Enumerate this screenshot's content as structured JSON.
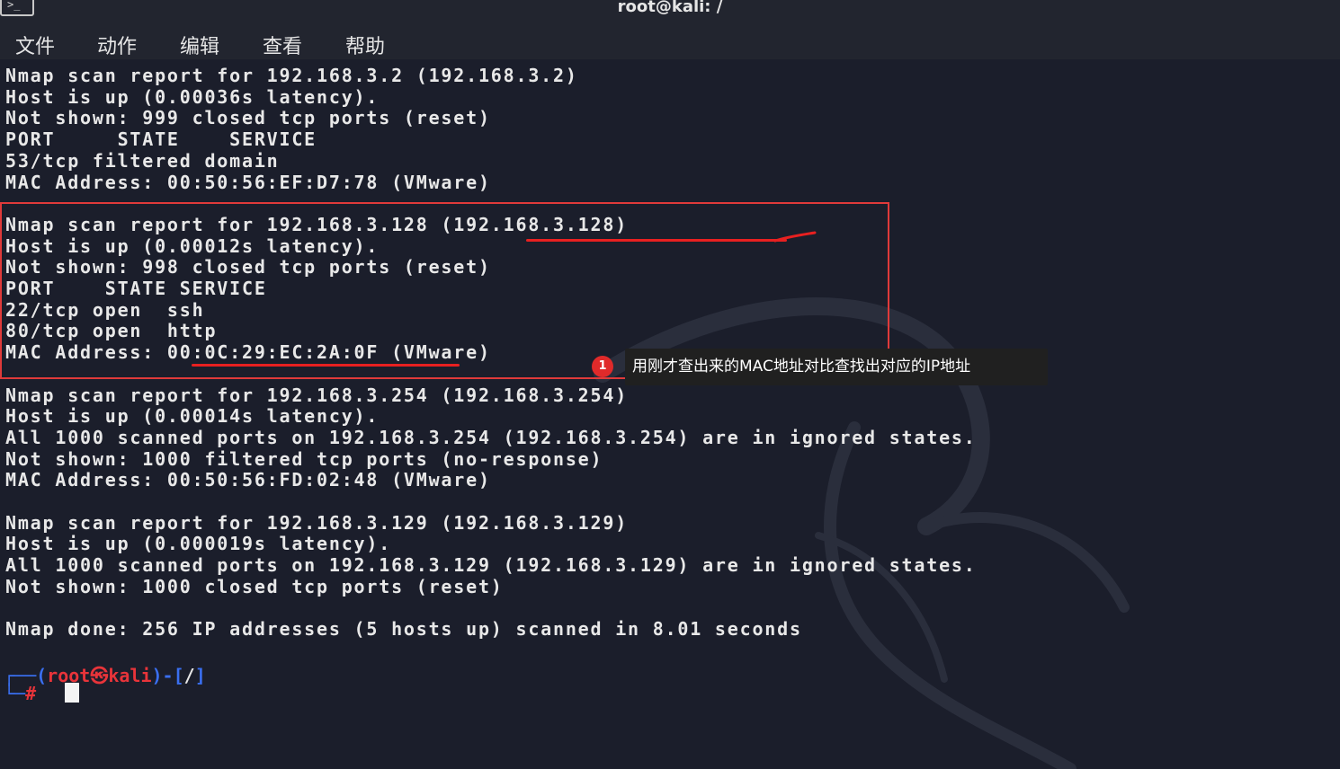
{
  "window": {
    "title": "root@kali: /"
  },
  "menu": [
    "文件",
    "动作",
    "编辑",
    "查看",
    "帮助"
  ],
  "terminal_lines": [
    "Nmap scan report for 192.168.3.2 (192.168.3.2)",
    "Host is up (0.00036s latency).",
    "Not shown: 999 closed tcp ports (reset)",
    "PORT     STATE    SERVICE",
    "53/tcp filtered domain",
    "MAC Address: 00:50:56:EF:D7:78 (VMware)",
    "",
    "Nmap scan report for 192.168.3.128 (192.168.3.128)",
    "Host is up (0.00012s latency).",
    "Not shown: 998 closed tcp ports (reset)",
    "PORT    STATE SERVICE",
    "22/tcp open  ssh",
    "80/tcp open  http",
    "MAC Address: 00:0C:29:EC:2A:0F (VMware)",
    "",
    "Nmap scan report for 192.168.3.254 (192.168.3.254)",
    "Host is up (0.00014s latency).",
    "All 1000 scanned ports on 192.168.3.254 (192.168.3.254) are in ignored states.",
    "Not shown: 1000 filtered tcp ports (no-response)",
    "MAC Address: 00:50:56:FD:02:48 (VMware)",
    "",
    "Nmap scan report for 192.168.3.129 (192.168.3.129)",
    "Host is up (0.000019s latency).",
    "All 1000 scanned ports on 192.168.3.129 (192.168.3.129) are in ignored states.",
    "Not shown: 1000 closed tcp ports (reset)",
    "",
    "Nmap done: 256 IP addresses (5 hosts up) scanned in 8.01 seconds"
  ],
  "prompt": {
    "corner_top": "┌──(",
    "user": "root",
    "at": "㉿",
    "host": "kali",
    "close": ")-[",
    "path": "/",
    "end": "]",
    "corner_bottom": "└─",
    "hash": "#"
  },
  "annotation": {
    "badge": "1",
    "text": "用刚才查出来的MAC地址对比查找出对应的IP地址"
  },
  "colors": {
    "background": "#1b1e2b",
    "text": "#e8e8e8",
    "prompt_blue": "#3a6ff0",
    "prompt_red": "#e8343a",
    "highlight": "#e03a3a"
  }
}
